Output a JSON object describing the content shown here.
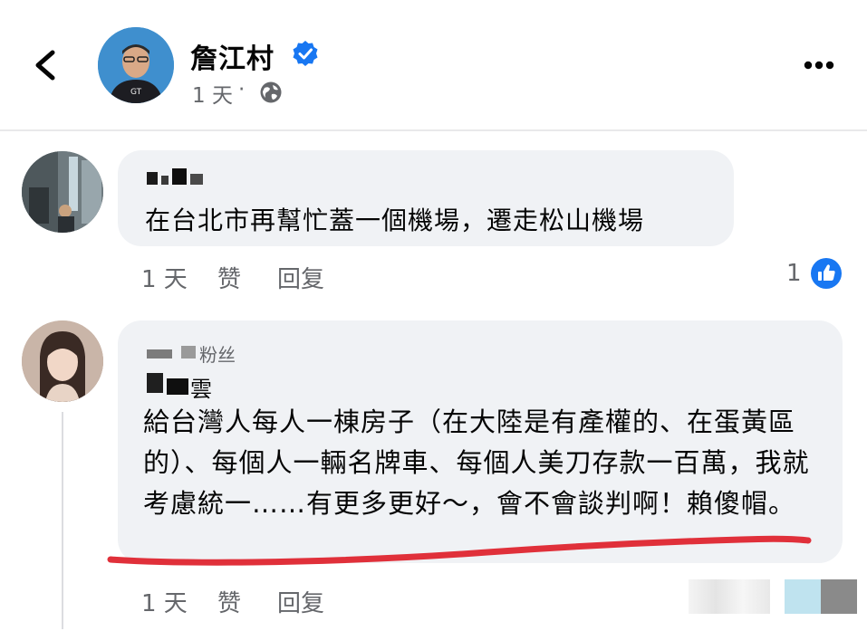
{
  "header": {
    "author_name": "詹江村",
    "post_time": "1 天",
    "separator": "·"
  },
  "comments": [
    {
      "text": "在台北市再幫忙蓋一個機場，遷走松山機場",
      "time": "1 天",
      "like_label": "赞",
      "reply_label": "回复",
      "like_count": "1"
    },
    {
      "badge": "粉丝",
      "name_suffix": "雲",
      "text": "給台灣人每人一棟房子（在大陸是有產權的、在蛋黃區的）、每個人一輛名牌車、每個人美刀存款一百萬，我就考慮統一……有更多更好～，會不會談判啊！賴傻帽。",
      "time": "1 天",
      "like_label": "赞",
      "reply_label": "回复"
    }
  ],
  "colors": {
    "facebook_blue": "#1877f2",
    "bubble_bg": "#f0f2f5",
    "meta_gray": "#65676b",
    "annotation_red": "#e0303a"
  },
  "icons": [
    "chevron-left-icon",
    "verified-icon",
    "globe-icon",
    "more-icon",
    "like-thumb-icon"
  ]
}
